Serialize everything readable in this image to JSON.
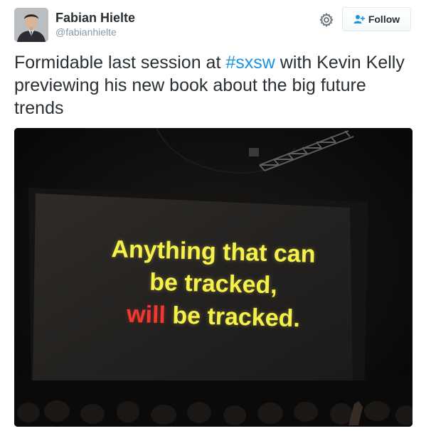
{
  "tweet": {
    "author": {
      "display_name": "Fabian Hielte",
      "handle": "@fabianhielte",
      "avatar_icon": "user-avatar"
    },
    "actions": {
      "settings_icon": "gear-icon",
      "follow_icon": "add-user-icon",
      "follow_label": "Follow"
    },
    "text": {
      "before_hashtag": "Formidable last session at ",
      "hashtag": "#sxsw",
      "after_hashtag": " with Kevin Kelly previewing his new book about the big future trends"
    },
    "media": {
      "slide": {
        "line1": "Anything that can",
        "line2": "be tracked,",
        "line3_red": "will",
        "line3_rest": " be tracked."
      }
    }
  },
  "colors": {
    "text": "#292f33",
    "handle": "#8899a6",
    "hashtag": "#1b95e0",
    "slide_yellow": "#f6f14a",
    "slide_red": "#ef3a30",
    "follow_icon": "#1b95e0"
  }
}
